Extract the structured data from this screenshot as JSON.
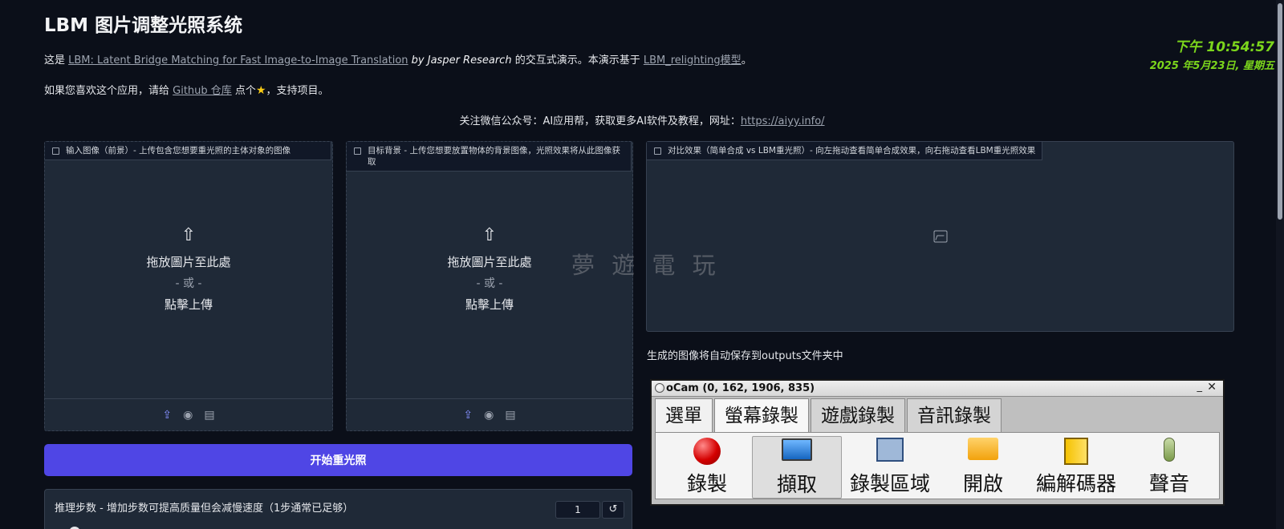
{
  "header": {
    "title": "LBM 图片调整光照系统",
    "intro": {
      "prefix": "这是 ",
      "paper_link": "LBM: Latent Bridge Matching for Fast Image-to-Image Translation",
      "author": " by Jasper Research",
      "middle": " 的交互式演示。本演示基于 ",
      "model_link": "LBM_relighting模型",
      "suffix": "。"
    },
    "like": {
      "prefix": "如果您喜欢这个应用，请给 ",
      "github_link": "Github 仓库",
      "middle": " 点个",
      "suffix": "，支持项目。"
    },
    "follow": {
      "text": "关注微信公众号：AI应用帮，获取更多AI软件及教程，网址：",
      "link": "https://aiyy.info/"
    }
  },
  "clock": {
    "time": "下午 10:54:57",
    "date": "2025 年5月23日, 星期五"
  },
  "panels": {
    "input": {
      "label": "输入图像（前景）- 上传包含您想要重光照的主体对象的图像",
      "drop": "拖放圖片至此處",
      "or": "- 或 -",
      "click": "點擊上傳"
    },
    "background": {
      "label": "目标背景 - 上传您想要放置物体的背景图像，光照效果将从此图像获取",
      "drop": "拖放圖片至此處",
      "or": "- 或 -",
      "click": "點擊上傳"
    },
    "result": {
      "label": "对比效果（简单合成 vs LBM重光照）- 向左拖动查看简单合成效果，向右拖动查看LBM重光照效果"
    }
  },
  "watermark": "夢 遊 電 玩",
  "run_button": "开始重光照",
  "save_note": "生成的图像将自动保存到outputs文件夹中",
  "steps": {
    "label": "推理步数 - 增加步数可提高质量但会减慢速度（1步通常已足够）",
    "value": "1",
    "reset": "↺"
  },
  "ocam": {
    "title": "oCam (0, 162, 1906, 835)",
    "min": "_",
    "close": "✕",
    "tabs": [
      "選單",
      "螢幕錄製",
      "遊戲錄製",
      "音訊錄製"
    ],
    "tools": [
      "錄製",
      "擷取",
      "錄製區域",
      "開啟",
      "編解碼器",
      "聲音"
    ]
  },
  "colors": {
    "background": "#0b0f19",
    "panel": "#1f2937",
    "accent": "#4f46e5",
    "clock": "#7cd61c"
  }
}
